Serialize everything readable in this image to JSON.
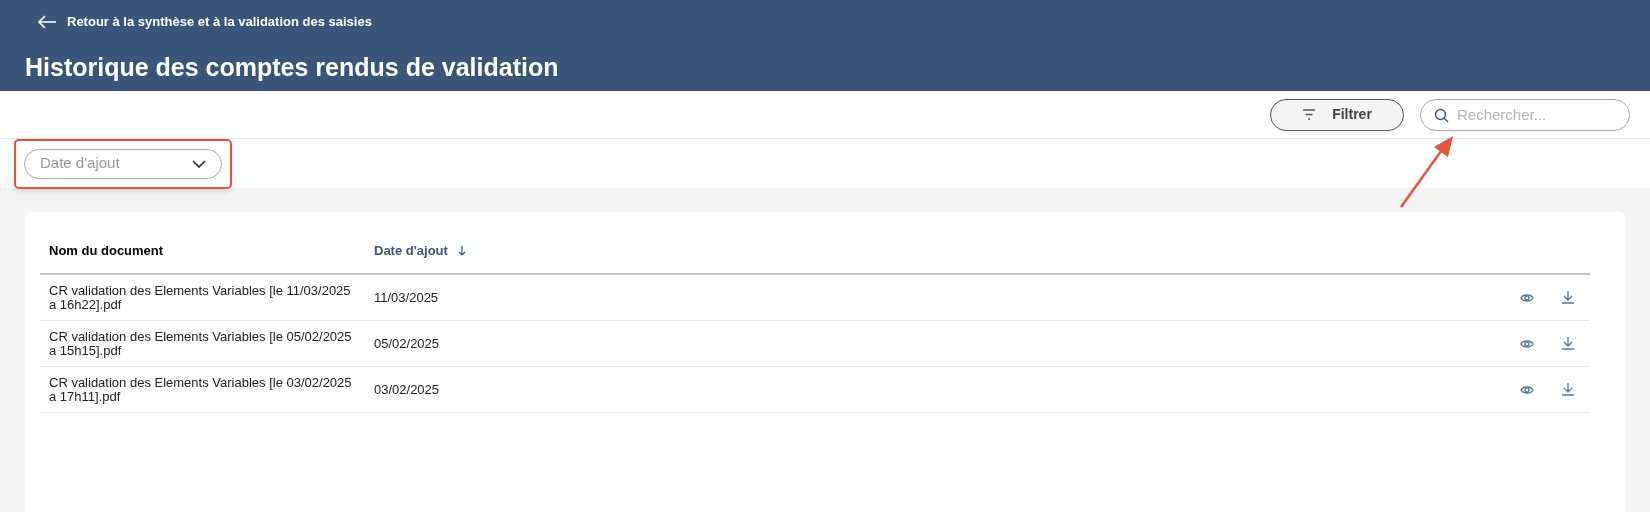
{
  "header": {
    "back_link": "Retour à la synthèse et à la validation des saisies",
    "title": "Historique des comptes rendus de validation"
  },
  "toolbar": {
    "filter_button": "Filtrer",
    "search": {
      "placeholder": "Rechercher..."
    }
  },
  "sort_select": {
    "placeholder": "Date d'ajout"
  },
  "table": {
    "columns": [
      {
        "label": "Nom du document",
        "sorted": false
      },
      {
        "label": "Date d'ajout",
        "sorted": true
      }
    ],
    "rows": [
      {
        "name": "CR validation des Elements Variables [le 11/03/2025 a 16h22].pdf",
        "date": "11/03/2025"
      },
      {
        "name": "CR validation des Elements Variables [le 05/02/2025 a 15h15].pdf",
        "date": "05/02/2025"
      },
      {
        "name": "CR validation des Elements Variables [le 03/02/2025 a 17h11].pdf",
        "date": "03/02/2025"
      }
    ]
  }
}
